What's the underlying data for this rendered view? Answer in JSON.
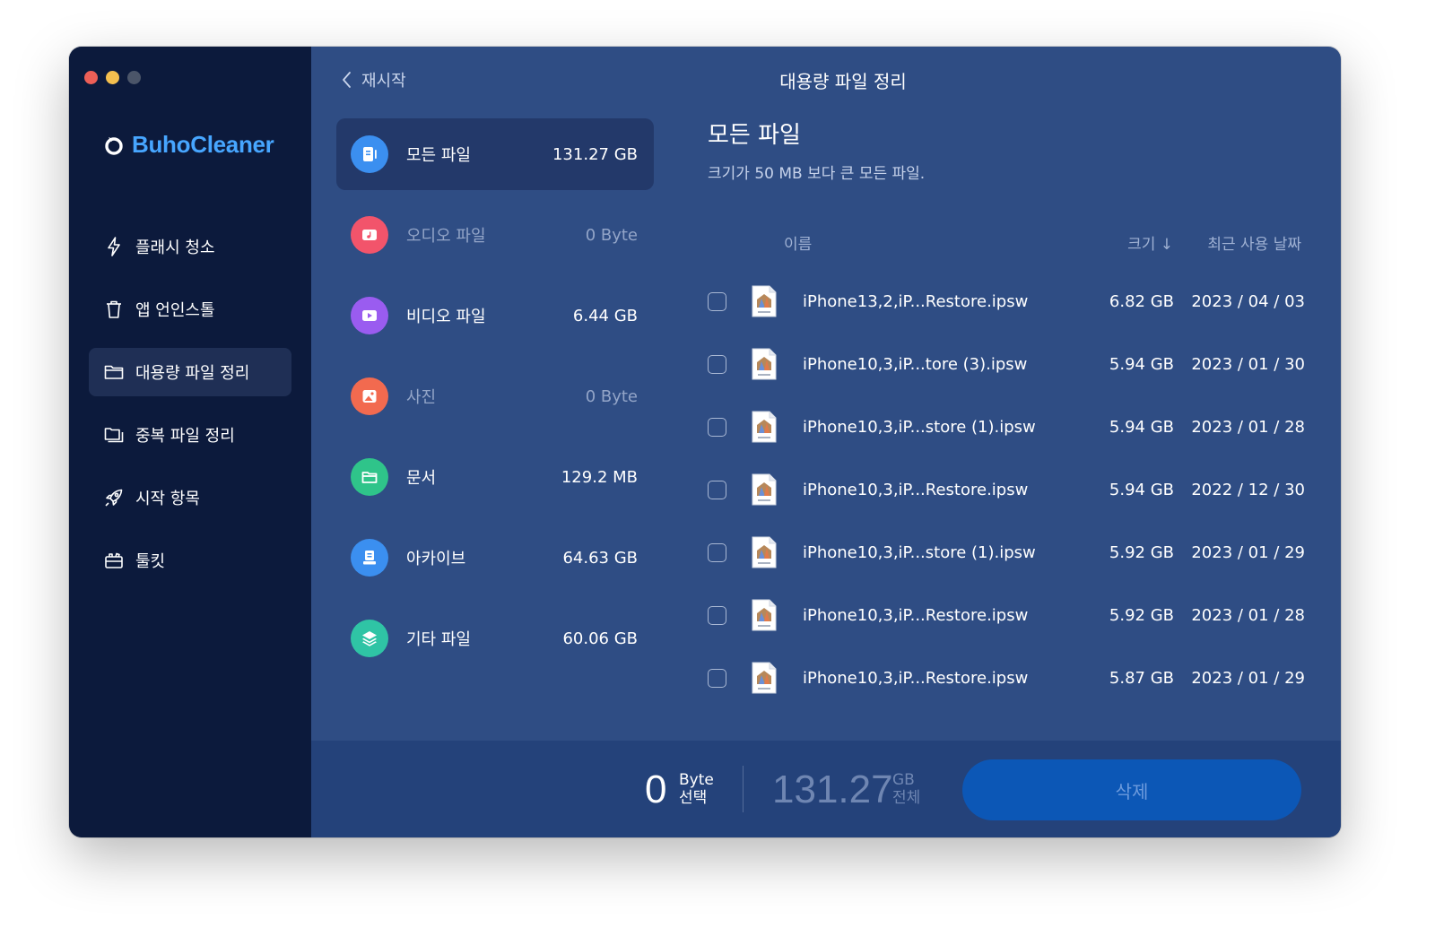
{
  "app": {
    "brand": "BuhoCleaner",
    "colors": {
      "accent": "#47a6ff",
      "sidebar": "#0c1a3c",
      "main": "#2f4d84",
      "button": "#0c57b6"
    }
  },
  "sidebar": {
    "items": [
      {
        "label": "플래시 청소",
        "icon": "lightning-icon",
        "active": false
      },
      {
        "label": "앱 언인스톨",
        "icon": "trash-icon",
        "active": false
      },
      {
        "label": "대용량 파일 정리",
        "icon": "folder-icon",
        "active": true
      },
      {
        "label": "중복 파일 정리",
        "icon": "folders-icon",
        "active": false
      },
      {
        "label": "시작 항목",
        "icon": "rocket-icon",
        "active": false
      },
      {
        "label": "툴킷",
        "icon": "toolbox-icon",
        "active": false
      }
    ]
  },
  "header": {
    "back_label": "재시작",
    "title": "대용량 파일 정리"
  },
  "categories": [
    {
      "label": "모든 파일",
      "size": "131.27 GB",
      "icon": "all-files-icon",
      "color": "#3b8ff0",
      "active": true
    },
    {
      "label": "오디오 파일",
      "size": "0 Byte",
      "icon": "audio-icon",
      "color": "#f2546b",
      "dim": true
    },
    {
      "label": "비디오 파일",
      "size": "6.44 GB",
      "icon": "video-icon",
      "color": "#9a5cf0"
    },
    {
      "label": "사진",
      "size": "0 Byte",
      "icon": "photo-icon",
      "color": "#f26a4f",
      "dim": true
    },
    {
      "label": "문서",
      "size": "129.2 MB",
      "icon": "document-icon",
      "color": "#2fc48a"
    },
    {
      "label": "아카이브",
      "size": "64.63 GB",
      "icon": "archive-icon",
      "color": "#3b8ff0"
    },
    {
      "label": "기타 파일",
      "size": "60.06 GB",
      "icon": "layers-icon",
      "color": "#2fc4a5"
    }
  ],
  "detail": {
    "title": "모든 파일",
    "subtitle": "크기가 50 MB 보다 큰 모든 파일.",
    "columns": {
      "name": "이름",
      "size": "크기 ↓",
      "date": "최근 사용 날짜"
    },
    "files": [
      {
        "name": "iPhone13,2,iP...Restore.ipsw",
        "size": "6.82 GB",
        "date": "2023 / 04 / 03"
      },
      {
        "name": "iPhone10,3,iP...tore (3).ipsw",
        "size": "5.94 GB",
        "date": "2023 / 01 / 30"
      },
      {
        "name": "iPhone10,3,iP...store (1).ipsw",
        "size": "5.94 GB",
        "date": "2023 / 01 / 28"
      },
      {
        "name": "iPhone10,3,iP...Restore.ipsw",
        "size": "5.94 GB",
        "date": "2022 / 12 / 30"
      },
      {
        "name": "iPhone10,3,iP...store (1).ipsw",
        "size": "5.92 GB",
        "date": "2023 / 01 / 29"
      },
      {
        "name": "iPhone10,3,iP...Restore.ipsw",
        "size": "5.92 GB",
        "date": "2023 / 01 / 28"
      },
      {
        "name": "iPhone10,3,iP...Restore.ipsw",
        "size": "5.87 GB",
        "date": "2023 / 01 / 29"
      }
    ]
  },
  "footer": {
    "selected_value": "0",
    "selected_unit": "Byte",
    "selected_label": "선택",
    "total_value": "131.27",
    "total_unit": "GB",
    "total_label": "전체",
    "delete_label": "삭제"
  }
}
